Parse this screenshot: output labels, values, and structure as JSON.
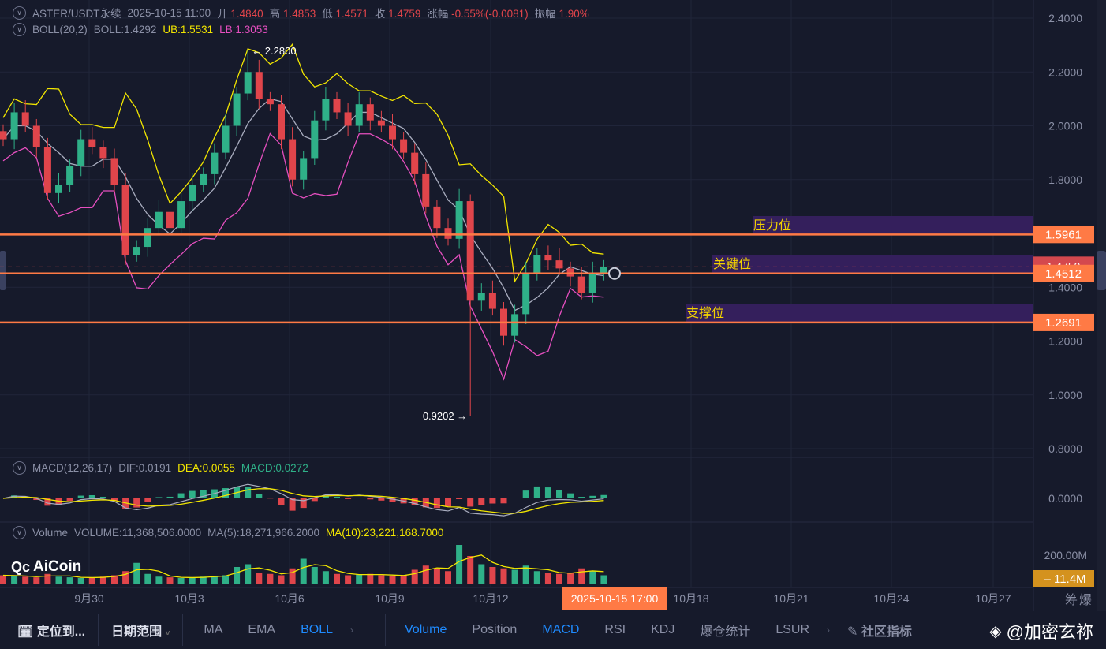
{
  "header": {
    "symbol": "ASTER/USDT永续",
    "datetime": "2025-10-15 11:00",
    "open_label": "开",
    "open": "1.4840",
    "high_label": "高",
    "high": "1.4853",
    "low_label": "低",
    "low": "1.4571",
    "close_label": "收",
    "close": "1.4759",
    "change_label": "涨幅",
    "change": "-0.55%(-0.0081)",
    "amp_label": "振幅",
    "amp": "1.90%"
  },
  "boll": {
    "name": "BOLL(20,2)",
    "mid": "BOLL:1.4292",
    "ub": "UB:1.5531",
    "lb": "LB:1.3053"
  },
  "macd": {
    "name": "MACD(12,26,17)",
    "dif": "DIF:0.0191",
    "dea": "DEA:0.0055",
    "macd": "MACD:0.0272"
  },
  "volume": {
    "name": "Volume",
    "vol": "VOLUME:11,368,506.0000",
    "ma5": "MA(5):18,271,966.2000",
    "ma10": "MA(10):23,221,168.7000",
    "current": "11.4M",
    "axis": [
      "200.00M"
    ]
  },
  "logo": "AiCoin",
  "levels": [
    {
      "label": "压力位",
      "price": "1.5961",
      "value": 1.5961
    },
    {
      "label": "关键位",
      "price": "1.4512",
      "value": 1.4512
    },
    {
      "label": "支撑位",
      "price": "1.2691",
      "value": 1.2691
    }
  ],
  "current_price": {
    "price": "1.4759",
    "value": 1.4759
  },
  "annotations": {
    "max": "2.2800",
    "min": "0.9202"
  },
  "colors": {
    "up": "#2fb088",
    "down": "#e0454b",
    "boll_mid": "#a9adbf",
    "ub": "#f2e600",
    "lb": "#e64fc0",
    "level": "#ff7a45",
    "zone": "#341f5c",
    "accent": "#1f8bff"
  },
  "chart_data": {
    "type": "candlestick",
    "y_ticks": [
      "2.4000",
      "2.2000",
      "2.0000",
      "1.8000",
      "1.6000",
      "1.4000",
      "1.2000",
      "1.0000",
      "0.8000"
    ],
    "ylim": [
      0.8,
      2.4
    ],
    "macd_ticks": [
      "0.0000"
    ],
    "x_ticks": [
      "9月30",
      "10月3",
      "10月6",
      "10月9",
      "10月12",
      "10月18",
      "10月21",
      "10月24",
      "10月27"
    ],
    "crosshair_time": "2025-10-15 17:00",
    "interval": "8h",
    "closes": [
      1.95,
      2.05,
      2.0,
      1.92,
      1.75,
      1.78,
      1.85,
      1.95,
      1.92,
      1.88,
      1.78,
      1.52,
      1.55,
      1.62,
      1.68,
      1.62,
      1.72,
      1.78,
      1.82,
      1.9,
      2.0,
      2.12,
      2.2,
      2.1,
      2.08,
      1.95,
      1.8,
      1.88,
      2.02,
      2.1,
      2.05,
      2.0,
      2.08,
      2.02,
      2.0,
      1.95,
      1.9,
      1.82,
      1.7,
      1.62,
      1.58,
      1.72,
      1.35,
      1.38,
      1.32,
      1.22,
      1.3,
      1.45,
      1.52,
      1.5,
      1.47,
      1.44,
      1.38,
      1.45,
      1.4759
    ],
    "volumes_M": [
      60,
      55,
      50,
      45,
      70,
      50,
      45,
      40,
      45,
      50,
      60,
      90,
      150,
      70,
      50,
      45,
      40,
      45,
      50,
      55,
      60,
      120,
      140,
      80,
      70,
      60,
      110,
      180,
      120,
      90,
      70,
      60,
      65,
      70,
      60,
      55,
      60,
      100,
      130,
      110,
      90,
      280,
      200,
      140,
      120,
      110,
      100,
      130,
      90,
      80,
      70,
      75,
      110,
      90,
      60
    ]
  },
  "toolbar": {
    "locate": "定位到...",
    "date_range": "日期范围",
    "items": [
      "MA",
      "EMA",
      "BOLL",
      "Volume",
      "Position",
      "MACD",
      "RSI",
      "KDJ",
      "爆仓统计",
      "LSUR",
      "社区指标"
    ],
    "right": [
      "筹",
      "爆"
    ]
  },
  "watermark": "@加密玄祢"
}
